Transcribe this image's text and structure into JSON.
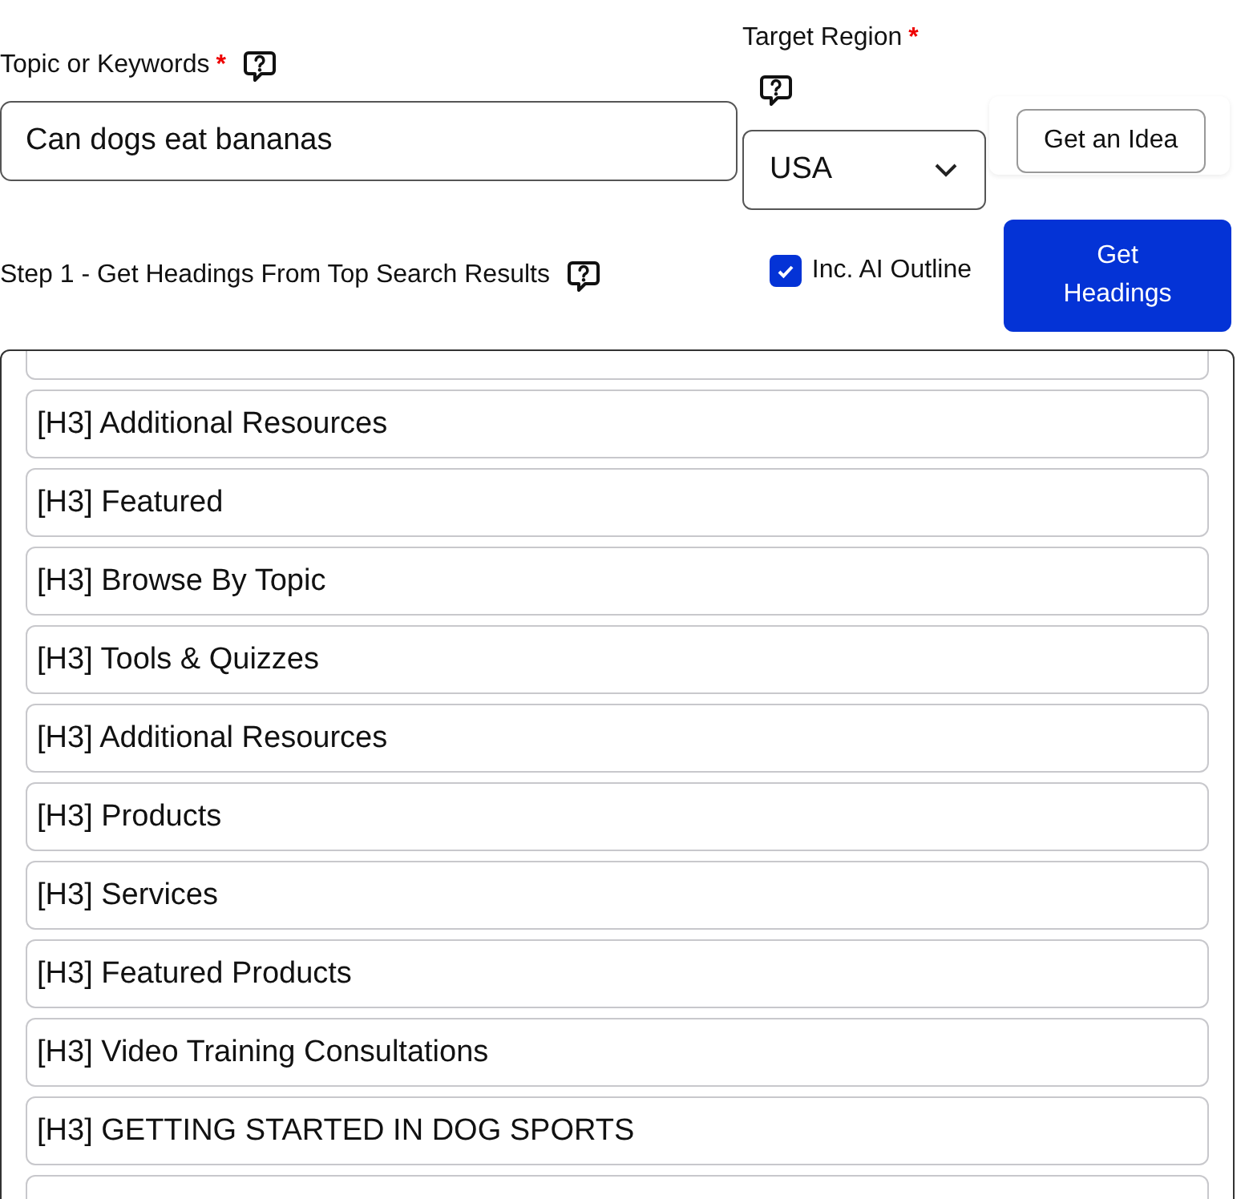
{
  "topic": {
    "label": "Topic or Keywords",
    "required_mark": "*",
    "value": "Can dogs eat bananas"
  },
  "region": {
    "label": "Target Region",
    "required_mark": "*",
    "value": "USA"
  },
  "idea_button": "Get an Idea",
  "step": {
    "label": "Step 1 - Get Headings From Top Search Results",
    "ai_outline": {
      "label": "Inc. AI Outline",
      "checked": true
    },
    "button": "Get Headings"
  },
  "headings": [
    {
      "kind": "cut_off"
    },
    {
      "kind": "heading",
      "text": "[H3] Additional Resources"
    },
    {
      "kind": "heading",
      "text": "[H3] Featured"
    },
    {
      "kind": "heading",
      "text": "[H3] Browse By Topic"
    },
    {
      "kind": "heading",
      "text": "[H3] Tools & Quizzes"
    },
    {
      "kind": "heading",
      "text": "[H3] Additional Resources"
    },
    {
      "kind": "heading",
      "text": "[H3] Products"
    },
    {
      "kind": "heading",
      "text": "[H3] Services"
    },
    {
      "kind": "heading",
      "text": "[H3] Featured Products"
    },
    {
      "kind": "heading",
      "text": "[H3] Video Training Consultations"
    },
    {
      "kind": "heading",
      "text": "[H3] GETTING STARTED IN DOG SPORTS"
    },
    {
      "kind": "cut_off"
    }
  ]
}
